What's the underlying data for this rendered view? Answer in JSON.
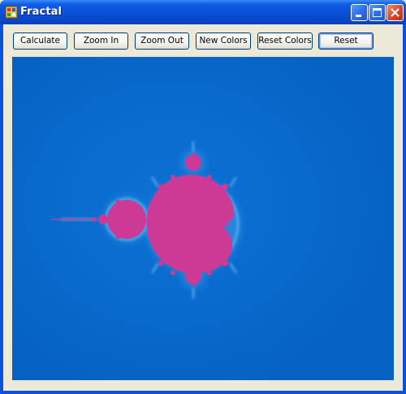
{
  "window": {
    "title": "Fractal",
    "icon": "fractal-app-icon",
    "controls": [
      "minimize-icon",
      "maximize-icon",
      "close-icon"
    ]
  },
  "toolbar": {
    "buttons": [
      {
        "label": "Calculate"
      },
      {
        "label": "Zoom In"
      },
      {
        "label": "Zoom Out"
      },
      {
        "label": "New Colors"
      },
      {
        "label": "Reset Colors"
      },
      {
        "label": "Reset"
      }
    ],
    "default_button": "Reset"
  },
  "canvas": {
    "content": "mandelbrot-set",
    "colors": {
      "background": "#0767c8",
      "set": "#cc3a96",
      "halo": "#4aa0e8"
    }
  }
}
